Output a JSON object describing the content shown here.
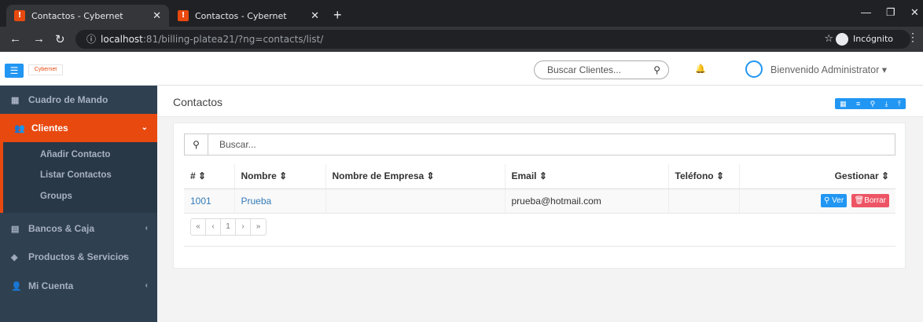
{
  "browser": {
    "tabs": [
      {
        "title": "Contactos - Cybernet"
      },
      {
        "title": "Contactos - Cybernet"
      }
    ],
    "url_host": "localhost",
    "url_rest": ":81/billing-platea21/?ng=contacts/list/",
    "incognito_label": "Incógnito"
  },
  "header": {
    "logo_text": "Cybernet",
    "search_placeholder": "Buscar Clientes...",
    "welcome": "Bienvenido Administrator ▾"
  },
  "sidebar": {
    "items": [
      {
        "label": "Cuadro de Mando",
        "icon": "dashboard-icon"
      },
      {
        "label": "Clientes",
        "icon": "users-icon"
      },
      {
        "label": "Bancos & Caja",
        "icon": "bank-icon"
      },
      {
        "label": "Productos & Servicios",
        "icon": "box-icon"
      },
      {
        "label": "Mi Cuenta",
        "icon": "user-icon"
      }
    ],
    "submenu": [
      "Añadir Contacto",
      "Listar Contactos",
      "Groups"
    ]
  },
  "page": {
    "title": "Contactos",
    "search_placeholder": "Buscar..."
  },
  "table": {
    "columns": [
      "# ⇕",
      "Nombre ⇕",
      "Nombre de Empresa ⇕",
      "Email ⇕",
      "Teléfono ⇕",
      "Gestionar ⇕"
    ],
    "rows": [
      {
        "id": "1001",
        "name": "Prueba",
        "company": "",
        "email": "prueba@hotmail.com",
        "phone": ""
      }
    ],
    "actions": {
      "view": "Ver",
      "delete": "Borrar"
    }
  },
  "pagination": {
    "first": "«",
    "prev": "‹",
    "current": "1",
    "next": "›",
    "last": "»"
  },
  "colors": {
    "accent": "#e8490f",
    "primary": "#2196f3",
    "sidebar": "#2f4050",
    "danger": "#ed5565"
  }
}
